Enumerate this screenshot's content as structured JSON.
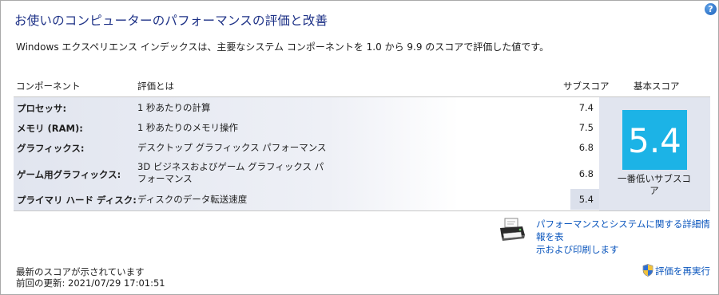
{
  "page": {
    "title": "お使いのコンピューターのパフォーマンスの評価と改善",
    "description": "Windows エクスペリエンス インデックスは、主要なシステム コンポーネントを 1.0 から 9.9 のスコアで評価した値です。"
  },
  "table": {
    "headers": {
      "component": "コンポーネント",
      "rated": "評価とは",
      "subscore": "サブスコア",
      "base": "基本スコア"
    },
    "rows": [
      {
        "label": "プロセッサ:",
        "desc": "1 秒あたりの計算",
        "score": "7.4"
      },
      {
        "label": "メモリ (RAM):",
        "desc": "1 秒あたりのメモリ操作",
        "score": "7.5"
      },
      {
        "label": "グラフィックス:",
        "desc": "デスクトップ グラフィックス パフォーマンス",
        "score": "6.8"
      },
      {
        "label": "ゲーム用グラフィックス:",
        "desc_line1": "3D ビジネスおよびゲーム グラフィックス パ",
        "desc_line2": "フォーマンス",
        "score": "6.8"
      },
      {
        "label": "プライマリ ハード ディスク:",
        "desc": "ディスクのデータ転送速度",
        "score": "5.4"
      }
    ],
    "base_score": "5.4",
    "base_caption_line1": "一番低いサブスコ",
    "base_caption_line2": "ア"
  },
  "details_link": {
    "line1": "パフォーマンスとシステムに関する詳細情報を表",
    "line2": "示および印刷します"
  },
  "footer": {
    "status": "最新のスコアが示されています",
    "last_update": "前回の更新: 2021/07/29 17:01:51",
    "rerun_label": "評価を再実行"
  },
  "icons": {
    "help": "help-icon",
    "printer": "printer-icon",
    "shield": "uac-shield-icon"
  },
  "colors": {
    "title": "#1e3287",
    "link": "#0b56bd",
    "score_tile": "#1cb3e6"
  }
}
